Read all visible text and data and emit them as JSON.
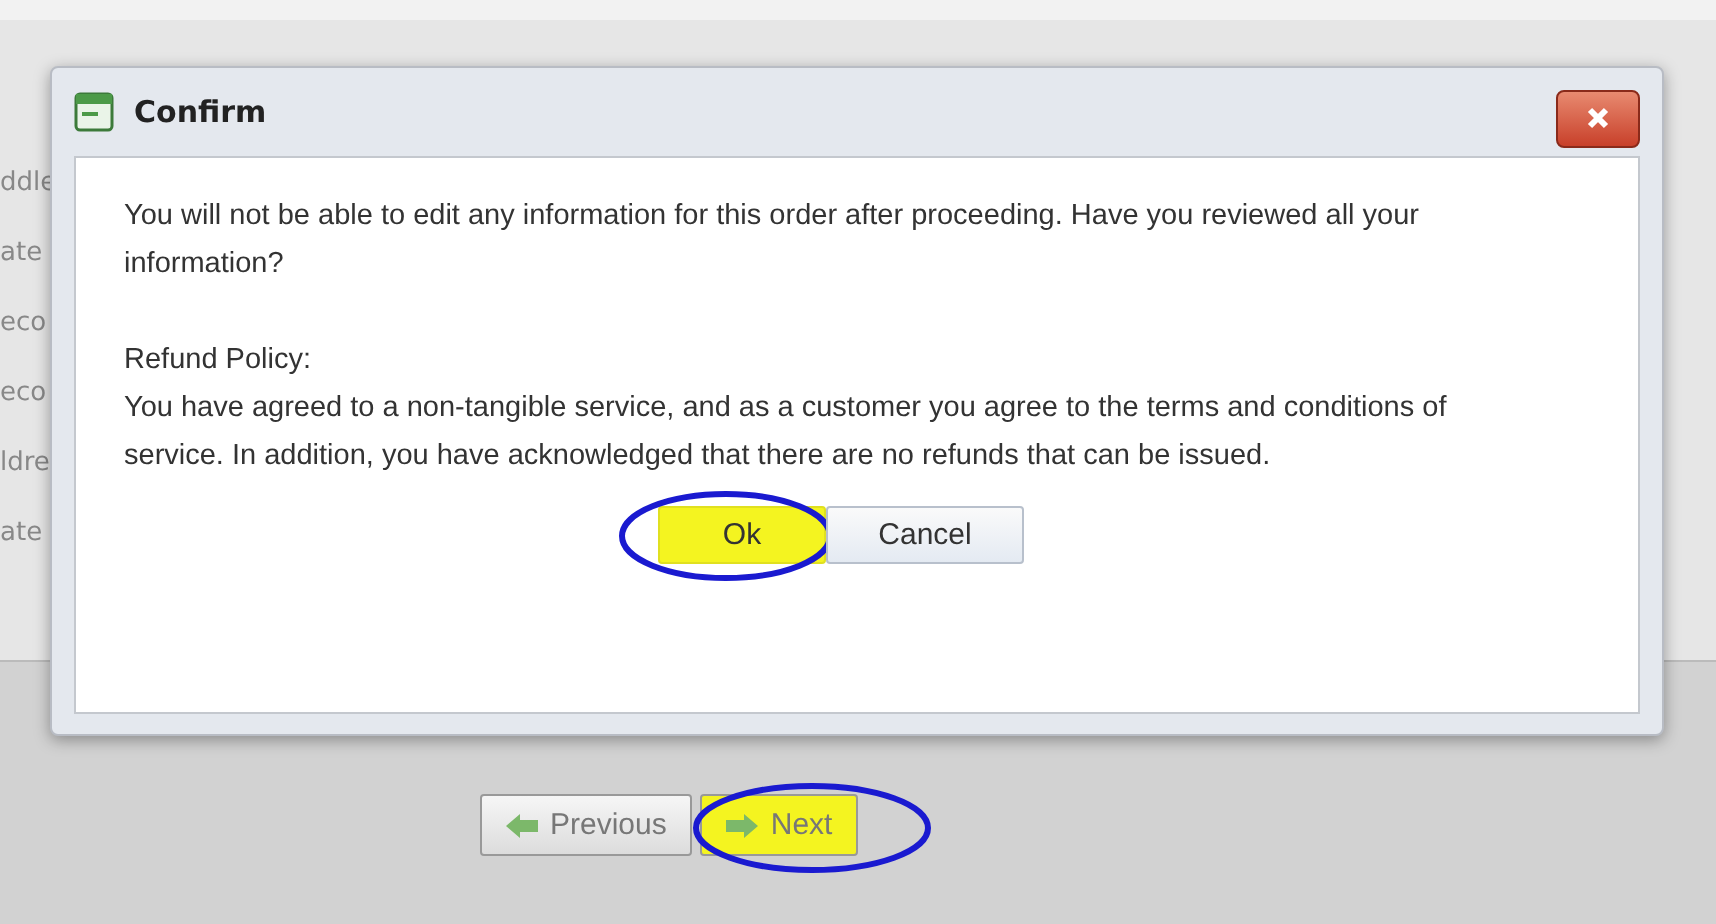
{
  "background_form": {
    "labels": [
      "ddle",
      "ate",
      "eco",
      "eco",
      "ldre",
      "ate"
    ]
  },
  "navigation": {
    "buttons": [
      {
        "kind": "previous",
        "label": "Previous",
        "highlighted": false
      },
      {
        "kind": "next",
        "label": "Next",
        "highlighted": true
      }
    ]
  },
  "dialog": {
    "title": "Confirm",
    "message": "You will not be able to edit any information for this order after proceeding. Have you reviewed all your information?",
    "policy_title": "Refund Policy:",
    "policy_text": "You have agreed to a non-tangible service, and as a customer you agree to the terms and conditions of service. In addition, you have acknowledged that there are no refunds that can be issued.",
    "buttons": [
      {
        "label": "Ok",
        "highlighted": true
      },
      {
        "label": "Cancel",
        "highlighted": false
      }
    ]
  }
}
